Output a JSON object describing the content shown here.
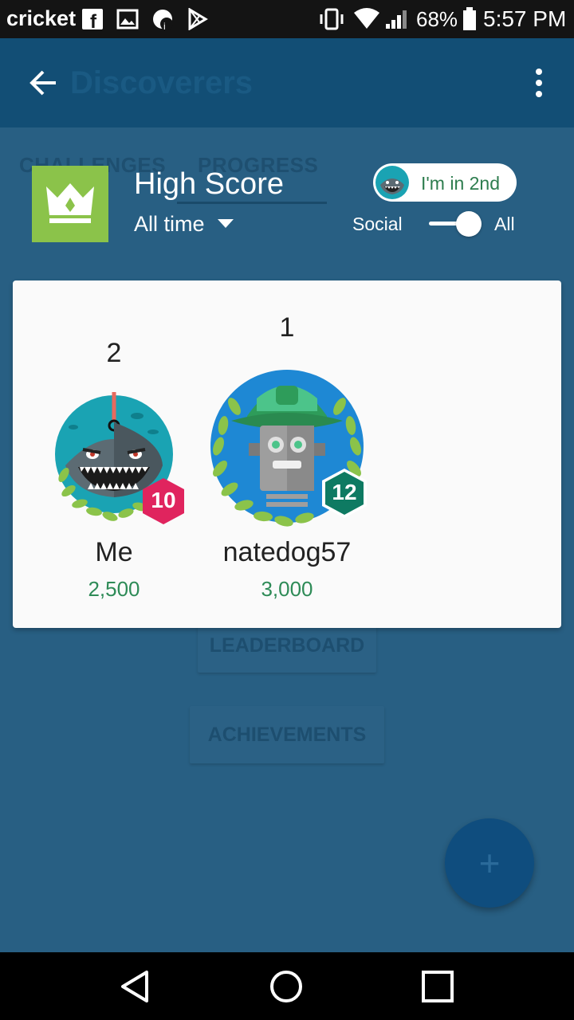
{
  "status_bar": {
    "carrier": "cricket",
    "battery_percent": "68%",
    "time": "5:57 PM"
  },
  "app_bar": {
    "title": "Discoverers",
    "back_icon": "arrow-back-icon",
    "menu_icon": "more-vert-icon"
  },
  "tabs": [
    {
      "label": "CHALLENGES"
    },
    {
      "label": "PROGRESS"
    }
  ],
  "background_buttons": {
    "leaderboard": "LEADERBOARD",
    "achievements": "ACHIEVEMENTS"
  },
  "fab": {
    "label": "+"
  },
  "leaderboard_header": {
    "title": "High Score",
    "time_range": "All time",
    "rank_badge": "I'm in 2nd",
    "toggle_left": "Social",
    "toggle_right": "All",
    "toggle_state": "All"
  },
  "players": [
    {
      "rank": "2",
      "name": "Me",
      "score": "2,500",
      "level": "10",
      "level_color": "#e0245e",
      "avatar": "shark-avatar"
    },
    {
      "rank": "1",
      "name": "natedog57",
      "score": "3,000",
      "level": "12",
      "level_color": "#0e7a62",
      "avatar": "robot-avatar"
    }
  ],
  "colors": {
    "app_bar": "#124e75",
    "crown_tile": "#8bc34a",
    "score_text": "#2e8b57",
    "scrim": "#285f83"
  }
}
